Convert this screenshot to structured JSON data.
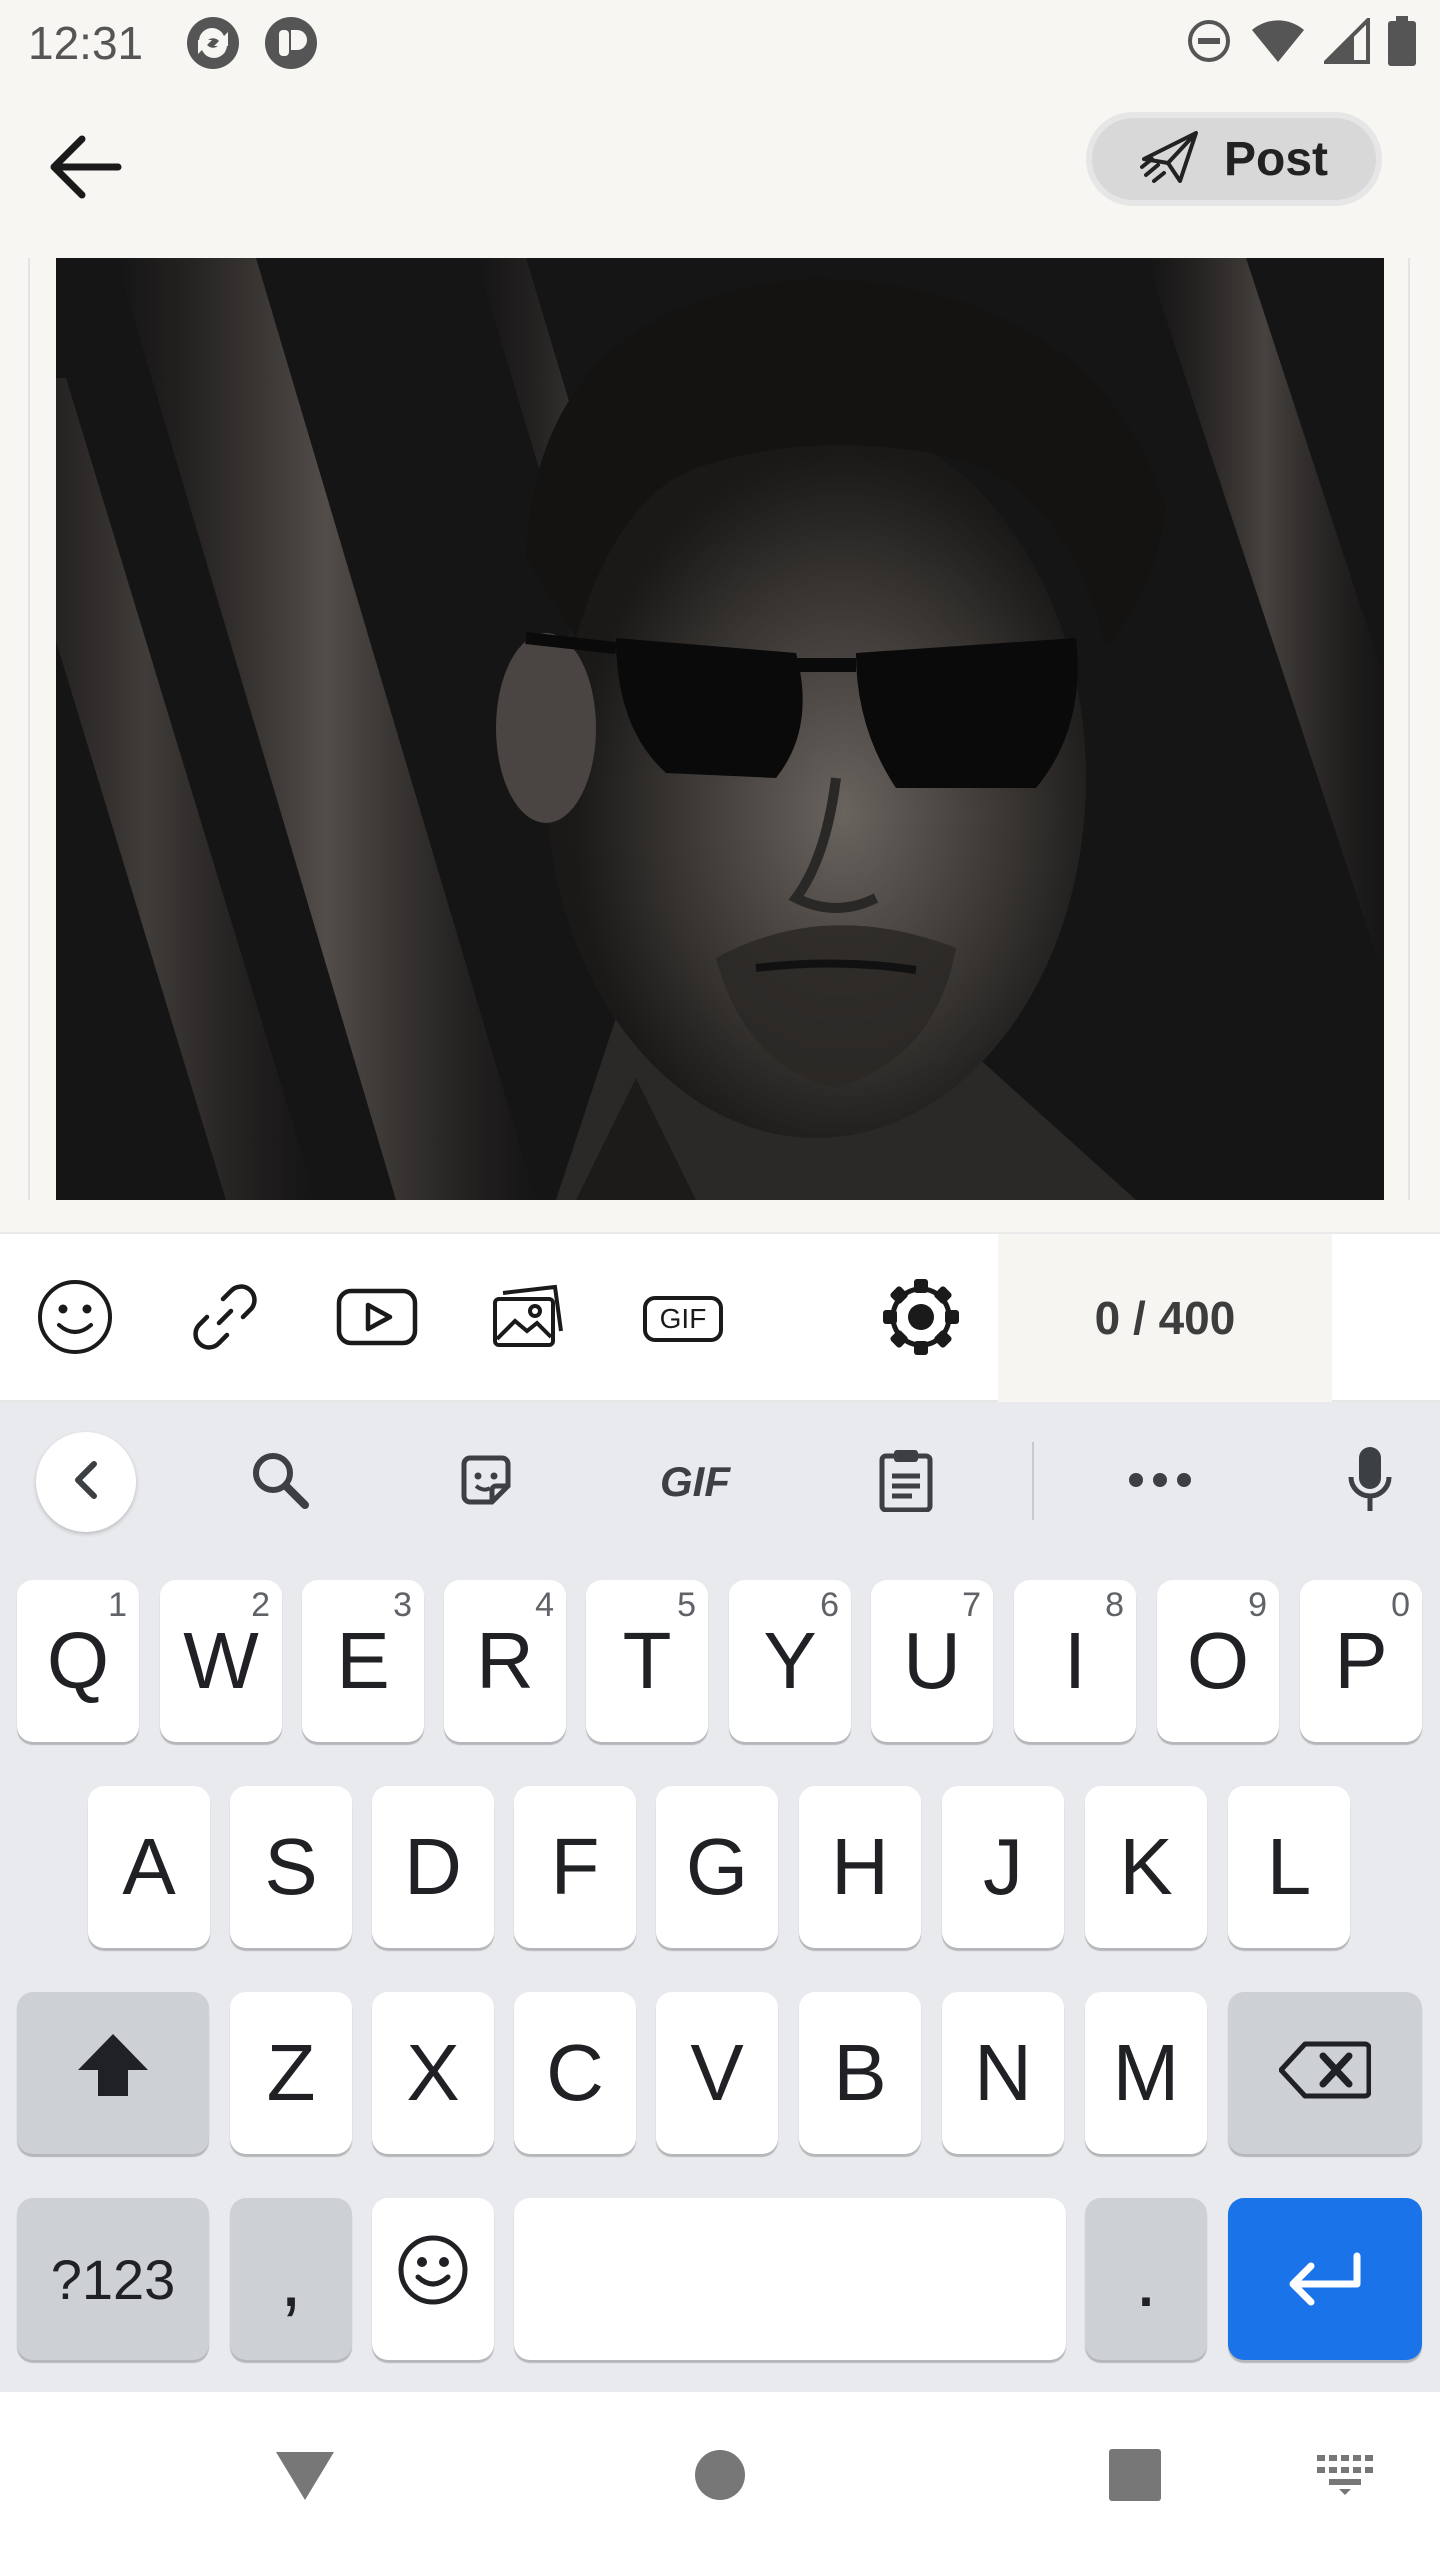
{
  "status_bar": {
    "time": "12:31",
    "icons": [
      "app-notification-icon",
      "app-notification-icon-2",
      "do-not-disturb-icon",
      "wifi-icon",
      "cellular-signal-icon",
      "battery-icon"
    ]
  },
  "top_bar": {
    "back_icon": "arrow-left-icon",
    "post_label": "Post",
    "post_icon": "paper-plane-icon"
  },
  "editor": {
    "image": "black-and-white portrait photo"
  },
  "toolbar": {
    "icons": [
      "emoji-icon",
      "link-icon",
      "video-icon",
      "image-gallery-icon",
      "gif-icon",
      "settings-icon"
    ],
    "gif_badge": "GIF",
    "char_count": "0 / 400"
  },
  "keyboard": {
    "strip": {
      "gif_label": "GIF",
      "icons": [
        "chevron-left-icon",
        "search-icon",
        "sticker-icon",
        "gif-icon",
        "clipboard-icon",
        "more-icon",
        "microphone-icon"
      ]
    },
    "row1": [
      {
        "label": "Q",
        "hint": "1"
      },
      {
        "label": "W",
        "hint": "2"
      },
      {
        "label": "E",
        "hint": "3"
      },
      {
        "label": "R",
        "hint": "4"
      },
      {
        "label": "T",
        "hint": "5"
      },
      {
        "label": "Y",
        "hint": "6"
      },
      {
        "label": "U",
        "hint": "7"
      },
      {
        "label": "I",
        "hint": "8"
      },
      {
        "label": "O",
        "hint": "9"
      },
      {
        "label": "P",
        "hint": "0"
      }
    ],
    "row2": [
      "A",
      "S",
      "D",
      "F",
      "G",
      "H",
      "J",
      "K",
      "L"
    ],
    "row3": [
      "Z",
      "X",
      "C",
      "V",
      "B",
      "N",
      "M"
    ],
    "symbols_label": "?123",
    "comma_label": ",",
    "period_label": ".",
    "accent_color": "#1a73e8"
  },
  "nav_bar": {
    "icons": [
      "back-triangle-icon",
      "home-circle-icon",
      "recents-square-icon",
      "keyboard-switch-icon"
    ]
  }
}
